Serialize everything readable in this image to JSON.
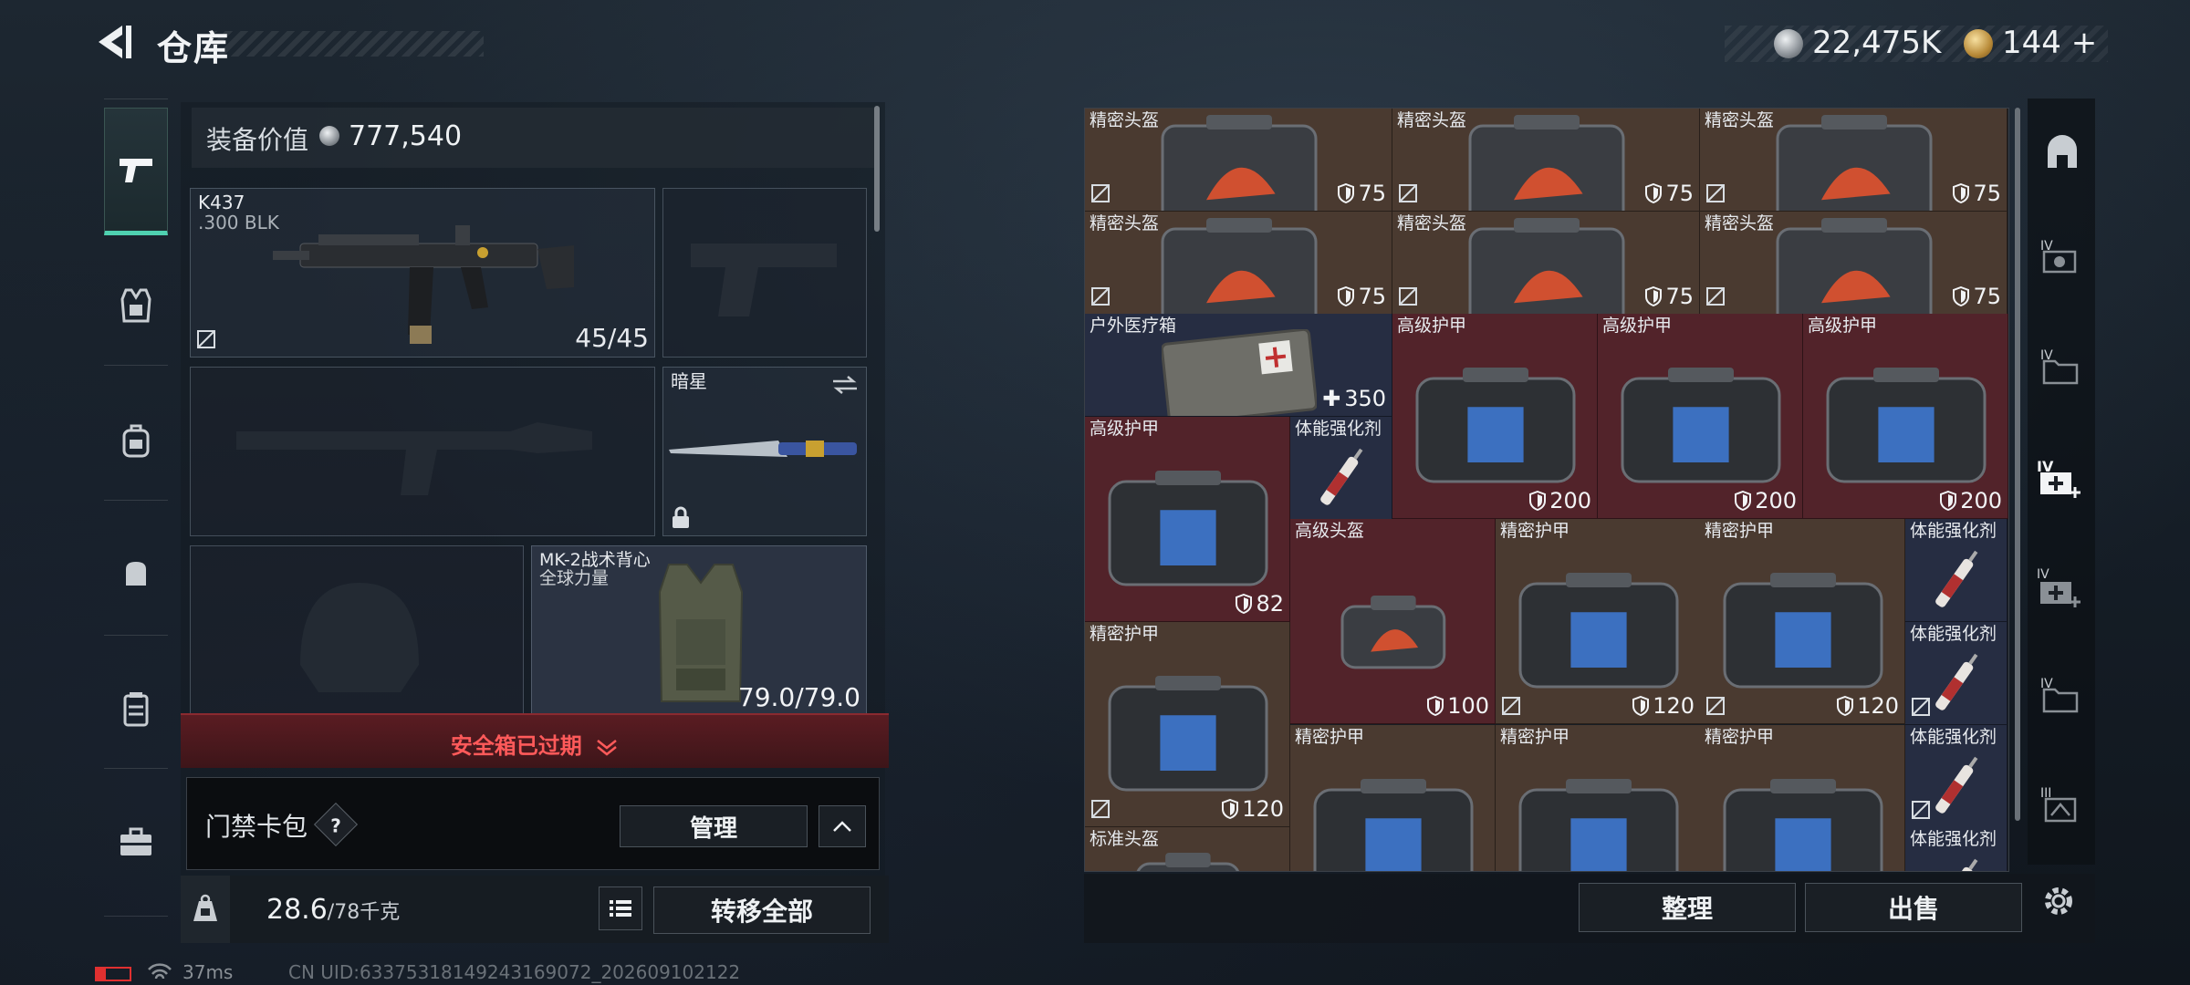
{
  "header": {
    "title": "仓库",
    "currency_primary": "22,475K",
    "currency_secondary": "144",
    "plus": "+"
  },
  "equipment": {
    "value_label": "装备价值",
    "value": "777,540",
    "weapon_primary": {
      "name": "K437",
      "ammo": ".300 BLK",
      "count": "45/45"
    },
    "melee": {
      "name": "暗星"
    },
    "vest": {
      "name": "MK-2战术背心",
      "sub": "全球力量",
      "durability": "79.0/79.0"
    },
    "alert": "安全箱已过期",
    "keycard_label": "门禁卡包",
    "keycard_help": "?",
    "manage": "管理",
    "weight": "28.6",
    "weight_max": "/78千克",
    "transfer_all": "转移全部"
  },
  "stash": {
    "items": [
      {
        "label": "精密头盔",
        "value": "75"
      },
      {
        "label": "精密头盔",
        "value": "75"
      },
      {
        "label": "精密头盔",
        "value": "75"
      },
      {
        "label": "精密头盔",
        "value": "75"
      },
      {
        "label": "精密头盔",
        "value": "75"
      },
      {
        "label": "精密头盔",
        "value": "75"
      },
      {
        "label": "户外医疗箱",
        "value": "350"
      },
      {
        "label": "高级护甲",
        "value": "200"
      },
      {
        "label": "高级护甲",
        "value": "200"
      },
      {
        "label": "高级护甲",
        "value": "200"
      },
      {
        "label": "高级护甲",
        "value": "82"
      },
      {
        "label": "体能强化剂",
        "value": ""
      },
      {
        "label": "高级头盔",
        "value": "100"
      },
      {
        "label": "精密护甲",
        "value": "120"
      },
      {
        "label": "精密护甲",
        "value": "120"
      },
      {
        "label": "体能强化剂",
        "value": ""
      },
      {
        "label": "精密护甲",
        "value": "120"
      },
      {
        "label": "体能强化剂",
        "value": ""
      },
      {
        "label": "精密护甲",
        "value": ""
      },
      {
        "label": "精密护甲",
        "value": ""
      },
      {
        "label": "精密护甲",
        "value": ""
      },
      {
        "label": "体能强化剂",
        "value": ""
      },
      {
        "label": "标准头盔",
        "value": ""
      },
      {
        "label": "体能强化剂",
        "value": ""
      }
    ],
    "sort_button": "整理",
    "sell_button": "出售"
  },
  "right_nav": {
    "tiers": [
      "IV",
      "IV",
      "IV",
      "IV",
      "IV",
      "III"
    ]
  },
  "status": {
    "ping": "37ms",
    "uid": "CN UID:633753181492431690​72_202609102122"
  },
  "colors": {
    "accent": "#4fd1b0",
    "alert": "#ff5a5a",
    "cell_brown": "#4a3a30",
    "cell_red": "#52232a",
    "cell_navy": "#262d42"
  }
}
